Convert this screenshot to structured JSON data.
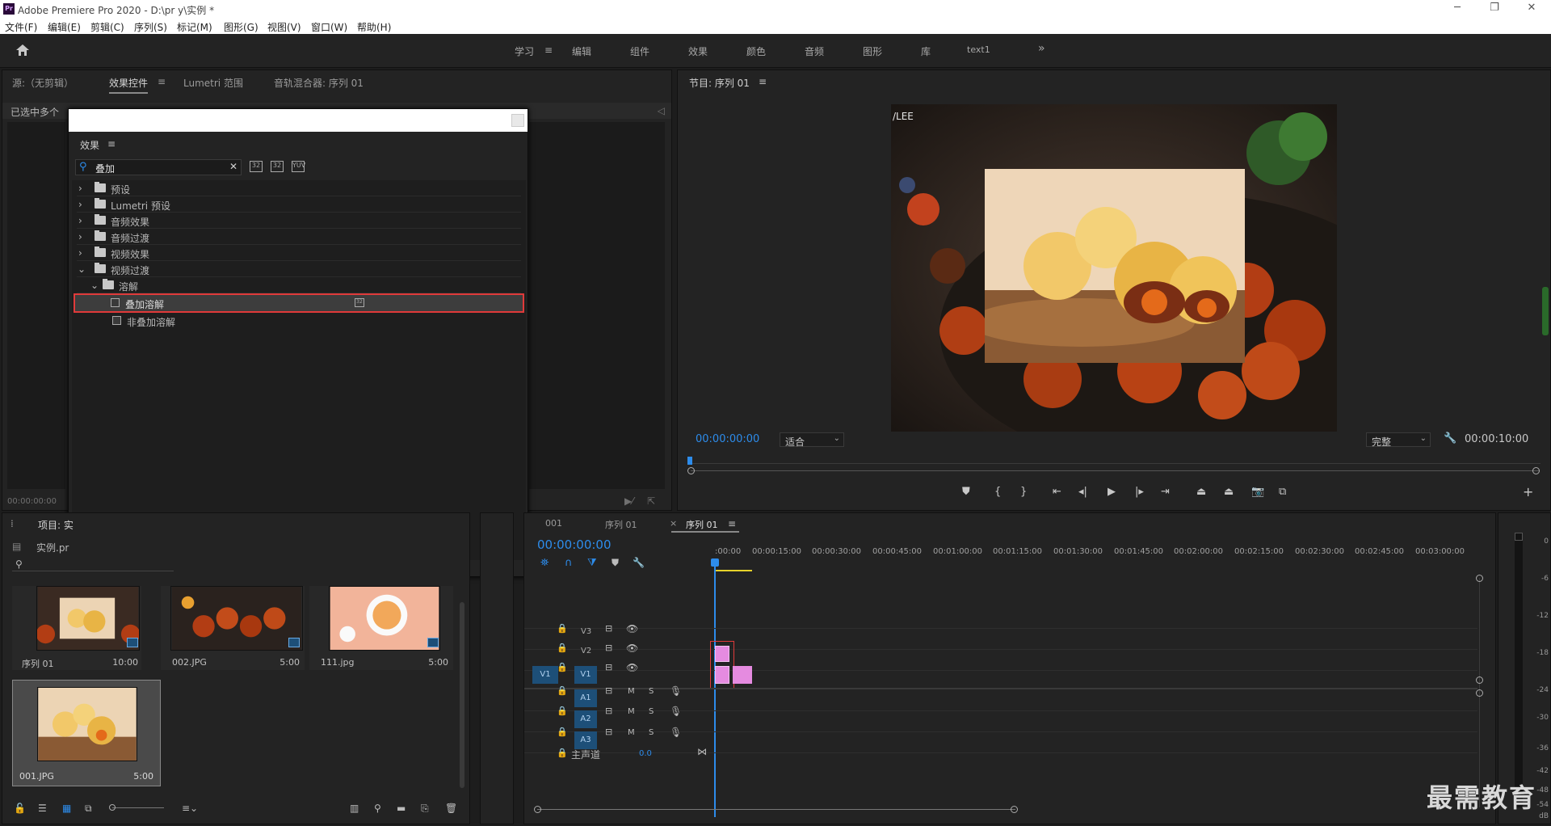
{
  "app": {
    "title": "Adobe Premiere Pro 2020 - D:\\pr y\\实例 *",
    "icon_text": "Pr",
    "window_controls": [
      "─",
      "❐",
      "✕"
    ]
  },
  "menu": [
    "文件(F)",
    "编辑(E)",
    "剪辑(C)",
    "序列(S)",
    "标记(M)",
    "图形(G)",
    "视图(V)",
    "窗口(W)",
    "帮助(H)"
  ],
  "workspaces": {
    "items": [
      "学习",
      "编辑",
      "组件",
      "效果",
      "颜色",
      "音频",
      "图形",
      "库",
      "text1"
    ],
    "active": "学习",
    "more": "»"
  },
  "source_panel": {
    "tabs": [
      "源:（无剪辑）",
      "效果控件",
      "Lumetri 范围",
      "音轨混合器: 序列 01"
    ],
    "active_tab": "效果控件",
    "header_text": "已选中多个",
    "timecode": "00:00:00:00"
  },
  "effects_panel": {
    "title": "效果",
    "search_value": "叠加",
    "tree": [
      {
        "label": "预设",
        "level": 0,
        "expanded": false,
        "kind": "folder"
      },
      {
        "label": "Lumetri 预设",
        "level": 0,
        "expanded": false,
        "kind": "folder"
      },
      {
        "label": "音频效果",
        "level": 0,
        "expanded": false,
        "kind": "folder"
      },
      {
        "label": "音频过渡",
        "level": 0,
        "expanded": false,
        "kind": "folder"
      },
      {
        "label": "视频效果",
        "level": 0,
        "expanded": false,
        "kind": "folder"
      },
      {
        "label": "视频过渡",
        "level": 0,
        "expanded": true,
        "kind": "folder"
      },
      {
        "label": "溶解",
        "level": 1,
        "expanded": true,
        "kind": "folder"
      },
      {
        "label": "叠加溶解",
        "level": 2,
        "kind": "effect",
        "selected": true
      },
      {
        "label": "非叠加溶解",
        "level": 2,
        "kind": "effect"
      }
    ]
  },
  "program_monitor": {
    "title": "节目: 序列 01",
    "watermark": "/LEE",
    "timecode_left": "00:00:00:00",
    "fit": "适合",
    "quality": "完整",
    "timecode_right": "00:00:10:00"
  },
  "project_panel": {
    "tab": "项目: 实",
    "name": "实例.pr",
    "items": [
      {
        "name": "序列 01",
        "duration": "10:00"
      },
      {
        "name": "002.JPG",
        "duration": "5:00"
      },
      {
        "name": "111.jpg",
        "duration": "5:00"
      },
      {
        "name": "001.JPG",
        "duration": "5:00"
      }
    ]
  },
  "timeline": {
    "tabs": [
      "001",
      "序列 01",
      "序列 01"
    ],
    "active_tab_index": 2,
    "close_mark": "×",
    "timecode": "00:00:00:00",
    "ruler": [
      ":00:00",
      "00:00:15:00",
      "00:00:30:00",
      "00:00:45:00",
      "00:01:00:00",
      "00:01:15:00",
      "00:01:30:00",
      "00:01:45:00",
      "00:02:00:00",
      "00:02:15:00",
      "00:02:30:00",
      "00:02:45:00",
      "00:03:00:00"
    ],
    "video_tracks": [
      "V3",
      "V2",
      "V1"
    ],
    "audio_tracks": [
      "A1",
      "A2",
      "A3"
    ],
    "source_patch": "V1",
    "track_m": "M",
    "track_s": "S",
    "master_label": "主声道",
    "master_value": "0.0"
  },
  "meter": {
    "labels": [
      "0",
      "-6",
      "-12",
      "-18",
      "-24",
      "-30",
      "-36",
      "-42",
      "-48",
      "-54"
    ],
    "footer": "dB"
  },
  "watermark_text": "最需教育",
  "colors": {
    "accent_blue": "#2d8ceb",
    "clip_pink": "#e58be0",
    "highlight_red": "#e03a3a",
    "panel_bg": "#232323"
  }
}
